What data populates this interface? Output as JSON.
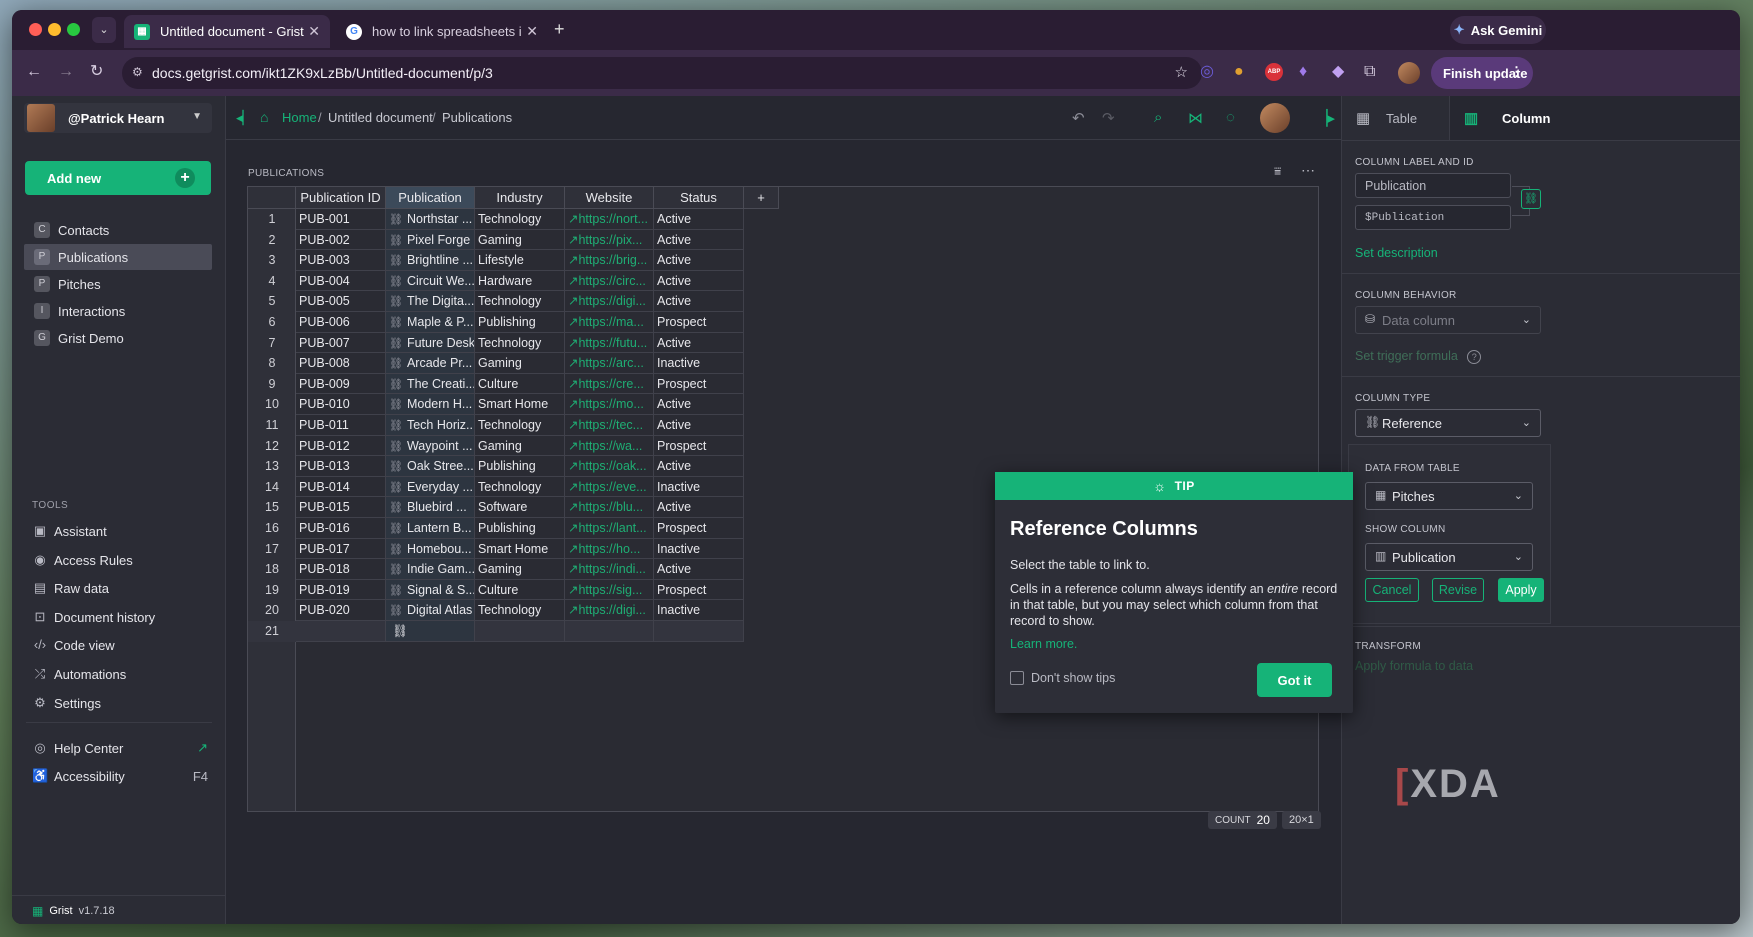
{
  "browser": {
    "tabs": [
      {
        "title": "Untitled document - Grist",
        "active": true
      },
      {
        "title": "how to link spreadsheets in g",
        "active": false
      }
    ],
    "new_tab": "+",
    "ask_gemini": "Ask Gemini",
    "url": "docs.getgrist.com/ikt1ZK9xLzBb/Untitled-document/p/3",
    "finish_update": "Finish update",
    "extension_abp": "ABP"
  },
  "sidebar": {
    "user": "@Patrick Hearn",
    "add_new": "Add new",
    "pages": [
      {
        "letter": "C",
        "label": "Contacts",
        "selected": false
      },
      {
        "letter": "P",
        "label": "Publications",
        "selected": true
      },
      {
        "letter": "P",
        "label": "Pitches",
        "selected": false
      },
      {
        "letter": "I",
        "label": "Interactions",
        "selected": false
      },
      {
        "letter": "G",
        "label": "Grist Demo",
        "selected": false
      }
    ],
    "tools_header": "TOOLS",
    "tools": [
      {
        "label": "Assistant",
        "icon": "assistant-icon"
      },
      {
        "label": "Access Rules",
        "icon": "shield-icon"
      },
      {
        "label": "Raw data",
        "icon": "database-icon"
      },
      {
        "label": "Document history",
        "icon": "history-icon"
      },
      {
        "label": "Code view",
        "icon": "code-icon"
      },
      {
        "label": "Automations",
        "icon": "automations-icon"
      },
      {
        "label": "Settings",
        "icon": "gear-icon"
      }
    ],
    "help_center": "Help Center",
    "accessibility": "Accessibility",
    "accessibility_shortcut": "F4",
    "app_name": "Grist",
    "version": "v1.7.18"
  },
  "breadcrumb": {
    "home": "Home",
    "sep": "/",
    "doc": "Untitled document",
    "page": "Publications"
  },
  "section": {
    "title": "PUBLICATIONS"
  },
  "table": {
    "columns": [
      "Publication ID",
      "Publication",
      "Industry",
      "Website",
      "Status"
    ],
    "add_column": "+",
    "rows": [
      [
        "1",
        "PUB-001",
        "Northstar ...",
        "Technology",
        "https://nort...",
        "Active"
      ],
      [
        "2",
        "PUB-002",
        "Pixel Forge",
        "Gaming",
        "https://pix...",
        "Active"
      ],
      [
        "3",
        "PUB-003",
        "Brightline ...",
        "Lifestyle",
        "https://brig...",
        "Active"
      ],
      [
        "4",
        "PUB-004",
        "Circuit We...",
        "Hardware",
        "https://circ...",
        "Active"
      ],
      [
        "5",
        "PUB-005",
        "The Digita...",
        "Technology",
        "https://digi...",
        "Active"
      ],
      [
        "6",
        "PUB-006",
        "Maple & P...",
        "Publishing",
        "https://ma...",
        "Prospect"
      ],
      [
        "7",
        "PUB-007",
        "Future Desk",
        "Technology",
        "https://futu...",
        "Active"
      ],
      [
        "8",
        "PUB-008",
        "Arcade Pr...",
        "Gaming",
        "https://arc...",
        "Inactive"
      ],
      [
        "9",
        "PUB-009",
        "The Creati...",
        "Culture",
        "https://cre...",
        "Prospect"
      ],
      [
        "10",
        "PUB-010",
        "Modern H...",
        "Smart Home",
        "https://mo...",
        "Active"
      ],
      [
        "11",
        "PUB-011",
        "Tech Horiz...",
        "Technology",
        "https://tec...",
        "Active"
      ],
      [
        "12",
        "PUB-012",
        "Waypoint ...",
        "Gaming",
        "https://wa...",
        "Prospect"
      ],
      [
        "13",
        "PUB-013",
        "Oak Stree...",
        "Publishing",
        "https://oak...",
        "Active"
      ],
      [
        "14",
        "PUB-014",
        "Everyday ...",
        "Technology",
        "https://eve...",
        "Inactive"
      ],
      [
        "15",
        "PUB-015",
        "Bluebird ...",
        "Software",
        "https://blu...",
        "Active"
      ],
      [
        "16",
        "PUB-016",
        "Lantern B...",
        "Publishing",
        "https://lant...",
        "Prospect"
      ],
      [
        "17",
        "PUB-017",
        "Homebou...",
        "Smart Home",
        "https://ho...",
        "Inactive"
      ],
      [
        "18",
        "PUB-018",
        "Indie Gam...",
        "Gaming",
        "https://indi...",
        "Active"
      ],
      [
        "19",
        "PUB-019",
        "Signal & S...",
        "Culture",
        "https://sig...",
        "Prospect"
      ],
      [
        "20",
        "PUB-020",
        "Digital Atlas",
        "Technology",
        "https://digi...",
        "Inactive"
      ]
    ],
    "new_row_number": "21",
    "count_label": "COUNT",
    "count_value": "20",
    "selection_size": "20×1"
  },
  "right_panel": {
    "tab_table": "Table",
    "tab_column": "Column",
    "label_header": "COLUMN LABEL AND ID",
    "label_value": "Publication",
    "id_value": "$Publication",
    "set_description": "Set description",
    "behavior_header": "COLUMN BEHAVIOR",
    "behavior_value": "Data column",
    "set_trigger": "Set trigger formula",
    "type_header": "COLUMN TYPE",
    "type_value": "Reference",
    "data_from_header": "DATA FROM TABLE",
    "data_from_value": "Pitches",
    "show_column_header": "SHOW COLUMN",
    "show_column_value": "Publication",
    "cancel": "Cancel",
    "revise": "Revise",
    "apply": "Apply",
    "transform_header": "TRANSFORM",
    "apply_formula": "Apply formula to data"
  },
  "tip": {
    "header": "TIP",
    "title": "Reference Columns",
    "line1": "Select the table to link to.",
    "body_pre": "Cells in a reference column always identify an ",
    "body_em": "entire",
    "body_post": " record in that table, but you may select which column from that record to show.",
    "learn_more": "Learn more.",
    "dont_show": "Don't show tips",
    "got_it": "Got it"
  },
  "watermark": "XDA",
  "colors": {
    "accent": "#16b378",
    "browser_chrome": "#3b2b48",
    "app_bg": "#262730"
  }
}
